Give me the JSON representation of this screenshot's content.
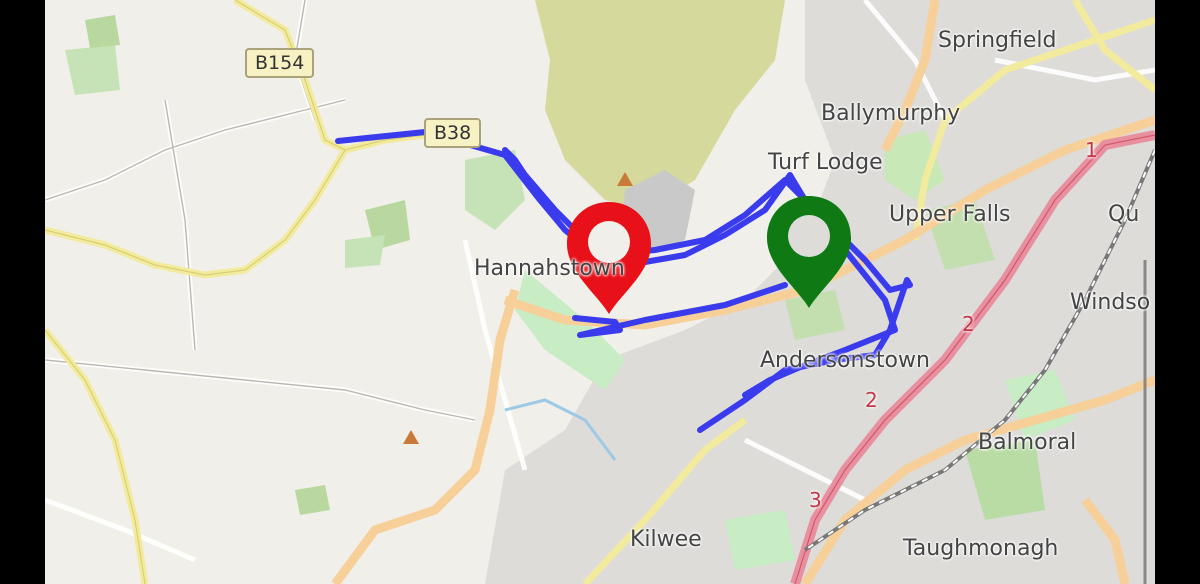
{
  "map": {
    "places": {
      "springfield": "Springfield",
      "ballymurphy": "Ballymurphy",
      "turf_lodge": "Turf Lodge",
      "upper_falls": "Upper Falls",
      "hannahstown": "Hannahstown",
      "andersonstown": "Andersonstown",
      "windsor": "Windso",
      "qu": "Qu",
      "balmoral": "Balmoral",
      "kilwee": "Kilwee",
      "taughmonagh": "Taughmonagh"
    },
    "road_refs": {
      "b154": "B154",
      "b38": "B38",
      "route_2a": "2",
      "route_2b": "2",
      "route_1": "1",
      "route_3": "3"
    },
    "route_color": "#3b3bee",
    "markers": {
      "start_color": "#e8111a",
      "end_color": "#0f7a13"
    },
    "icons": [
      "map-pin-red-icon",
      "map-pin-green-icon",
      "peak-triangle-icon"
    ]
  }
}
